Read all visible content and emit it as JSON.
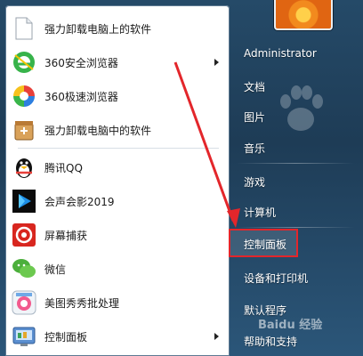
{
  "colors": {
    "accent_red": "#e3262b",
    "panel_blue": "#1e3c56",
    "list_bg": "#ffffff"
  },
  "left_menu": {
    "items": [
      {
        "label": "强力卸载电脑上的软件",
        "icon": "file-icon",
        "has_submenu": false
      },
      {
        "label": "360安全浏览器",
        "icon": "360-browser-icon",
        "has_submenu": true
      },
      {
        "label": "360极速浏览器",
        "icon": "360-speed-browser-icon",
        "has_submenu": false
      },
      {
        "label": "强力卸载电脑中的软件",
        "icon": "uninstall-icon",
        "has_submenu": false
      },
      {
        "label": "腾讯QQ",
        "icon": "qq-penguin-icon",
        "has_submenu": false
      },
      {
        "label": "会声会影2019",
        "icon": "corel-video-icon",
        "has_submenu": false
      },
      {
        "label": "屏幕捕获",
        "icon": "screen-capture-icon",
        "has_submenu": false
      },
      {
        "label": "微信",
        "icon": "wechat-icon",
        "has_submenu": false
      },
      {
        "label": "美图秀秀批处理",
        "icon": "meitu-icon",
        "has_submenu": false
      },
      {
        "label": "控制面板",
        "icon": "control-panel-icon",
        "has_submenu": true
      }
    ]
  },
  "right_menu": {
    "items": [
      {
        "label": "Administrator"
      },
      {
        "label": "文档"
      },
      {
        "label": "图片"
      },
      {
        "label": "音乐"
      },
      {
        "label": "游戏"
      },
      {
        "label": "计算机"
      },
      {
        "label": "控制面板"
      },
      {
        "label": "设备和打印机"
      },
      {
        "label": "默认程序"
      },
      {
        "label": "帮助和支持"
      }
    ]
  },
  "watermark": {
    "text": "Baidu 经验"
  }
}
